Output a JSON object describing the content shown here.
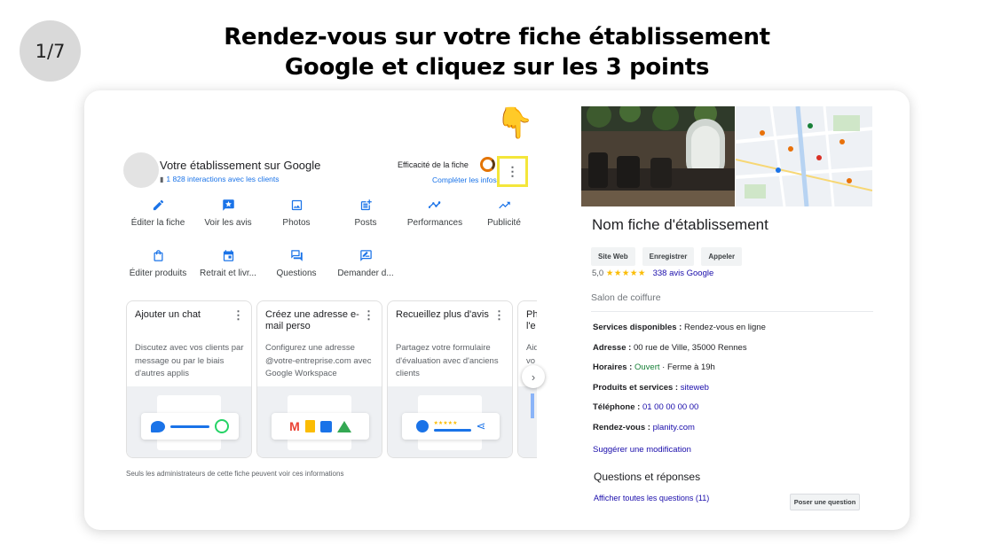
{
  "step": "1/7",
  "headline": [
    "Rendez-vous sur votre fiche établissement",
    "Google et cliquez sur les 3 points"
  ],
  "profile": {
    "title": "Votre établissement sur Google",
    "interactions": "1 828 interactions avec les clients",
    "efficacite_label": "Efficacité de la fiche",
    "completer_label": "Compléter les infos",
    "more_menu_glyph": "⋮",
    "pointer_glyph": "👇"
  },
  "actions_row1": [
    "Éditer la fiche",
    "Voir les avis",
    "Photos",
    "Posts",
    "Performances",
    "Publicité"
  ],
  "actions_row2": [
    "Éditer produits",
    "Retrait et livr...",
    "Questions",
    "Demander d..."
  ],
  "tips": [
    {
      "title": "Ajouter un chat",
      "desc": "Discutez avec vos clients par message ou par le biais d'autres applis"
    },
    {
      "title": "Créez une adresse e-mail perso",
      "desc": "Configurez une adresse @votre-entreprise.com avec Google Workspace"
    },
    {
      "title": "Recueillez plus d'avis",
      "desc": "Partagez votre formulaire d'évaluation avec d'anciens clients"
    },
    {
      "title": "Ph l'e",
      "desc": "Aid vo"
    }
  ],
  "admin_note": "Seuls les administrateurs de cette fiche peuvent voir ces informations",
  "listing": {
    "name": "Nom fiche d'établissement",
    "buttons": [
      "Site Web",
      "Enregistrer",
      "Appeler"
    ],
    "rating_value": "5,0",
    "stars": "★★★★★",
    "reviews_link": "338 avis Google",
    "category": "Salon de coiffure",
    "services_label": "Services disponibles :",
    "services_value": "Rendez-vous en ligne",
    "adresse_label": "Adresse :",
    "adresse_value": "00 rue de Ville, 35000 Rennes",
    "horaires_label": "Horaires :",
    "horaires_open": "Ouvert",
    "horaires_close": "· Ferme à 19h",
    "produits_label": "Produits et services :",
    "produits_value": "siteweb",
    "telephone_label": "Téléphone :",
    "telephone_value": "01 00 00 00 00",
    "rdv_label": "Rendez-vous :",
    "rdv_value": "planity.com",
    "suggest": "Suggérer une modification",
    "qa_title": "Questions et réponses",
    "qa_link": "Afficher toutes les questions (11)",
    "ask_button": "Poser une question"
  },
  "colors": {
    "highlight": "#f4e63a",
    "link": "#1a73e8",
    "accent": "#e37400"
  }
}
